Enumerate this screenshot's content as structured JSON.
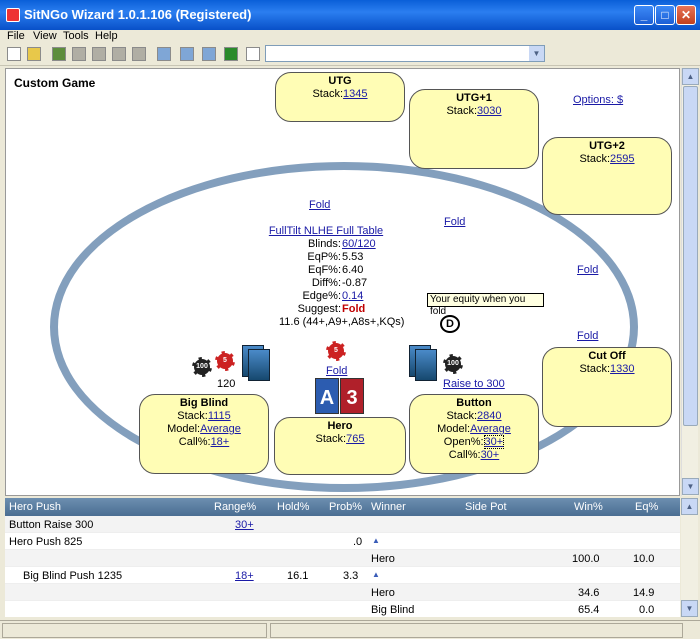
{
  "window": {
    "title": "SitNGo Wizard 1.0.1.106 (Registered)"
  },
  "menu": [
    "File",
    "View",
    "Tools",
    "Help"
  ],
  "game_title": "Custom Game",
  "options_link": "Options: $",
  "seats": {
    "utg": {
      "name": "UTG",
      "stack_label": "Stack:",
      "stack": "1345"
    },
    "utg1": {
      "name": "UTG+1",
      "stack_label": "Stack:",
      "stack": "3030"
    },
    "utg2": {
      "name": "UTG+2",
      "stack_label": "Stack:",
      "stack": "2595"
    },
    "cutoff": {
      "name": "Cut Off",
      "stack_label": "Stack:",
      "stack": "1330"
    },
    "button": {
      "name": "Button",
      "stack_label": "Stack:",
      "stack": "2840",
      "model_label": "Model:",
      "model": "Average",
      "open_label": "Open%:",
      "open": "30+",
      "call_label": "Call%:",
      "call": "30+"
    },
    "hero": {
      "name": "Hero",
      "stack_label": "Stack:",
      "stack": "765"
    },
    "bigblind": {
      "name": "Big Blind",
      "stack_label": "Stack:",
      "stack": "1115",
      "model_label": "Model:",
      "model": "Average",
      "call_label": "Call%:",
      "call": "18+"
    }
  },
  "actions": {
    "fold_utg": "Fold",
    "fold_utg1": "Fold",
    "fold_utg2": "Fold",
    "fold_cutoff": "Fold",
    "hero_fold": "Fold",
    "button_raise": "Raise to 300",
    "bb_bet": "120"
  },
  "info": {
    "game_link": "FullTilt NLHE Full Table",
    "blinds_label": "Blinds:",
    "blinds": "60/120",
    "eqp_label": "EqP%:",
    "eqp": "5.53",
    "eqf_label": "EqF%:",
    "eqf": "6.40",
    "diff_label": "Diff%:",
    "diff": "-0.87",
    "edge_label": "Edge%:",
    "edge": "0.14",
    "suggest_label": "Suggest:",
    "suggest": "Fold",
    "range": "11.6 (44+,A9+,A8s+,KQs)"
  },
  "tooltip": "Your equity when you fold",
  "dealer": "D",
  "hero_cards": [
    "A",
    "3"
  ],
  "chips": {
    "c1": "100",
    "c2": "5",
    "c3": "5",
    "c4": "100"
  },
  "table": {
    "headers": [
      "Hero Push",
      "Range%",
      "Hold%",
      "Prob%",
      "Winner",
      "Side Pot",
      "Win%",
      "Eq%"
    ],
    "rows": [
      {
        "c0": "Button Raise 300",
        "c1": "30+",
        "c2": "",
        "c3": "",
        "c4": "",
        "c6": "",
        "c7": ""
      },
      {
        "c0": "Hero Push 825",
        "c1": "",
        "c2": "",
        "c3": ".0",
        "c4": "▲",
        "c6": "",
        "c7": ""
      },
      {
        "c0": "",
        "c1": "",
        "c2": "",
        "c3": "",
        "c4": "Hero",
        "c6": "100.0",
        "c7": "10.0"
      },
      {
        "c0": "Big Blind Push 1235",
        "c1": "18+",
        "c2": "16.1",
        "c3": "3.3",
        "c4": "▲",
        "c6": "",
        "c7": ""
      },
      {
        "c0": "",
        "c1": "",
        "c2": "",
        "c3": "",
        "c4": "Hero",
        "c6": "34.6",
        "c7": "14.9"
      },
      {
        "c0": "",
        "c1": "",
        "c2": "",
        "c3": "",
        "c4": "Big Blind",
        "c6": "65.4",
        "c7": "0.0"
      }
    ]
  },
  "colors": {
    "title_bar": "#0a5fd8",
    "seat_fill": "#fffdb5",
    "ring": "#839fbd",
    "link": "#1a1aa6",
    "suggest": "#c00000"
  }
}
